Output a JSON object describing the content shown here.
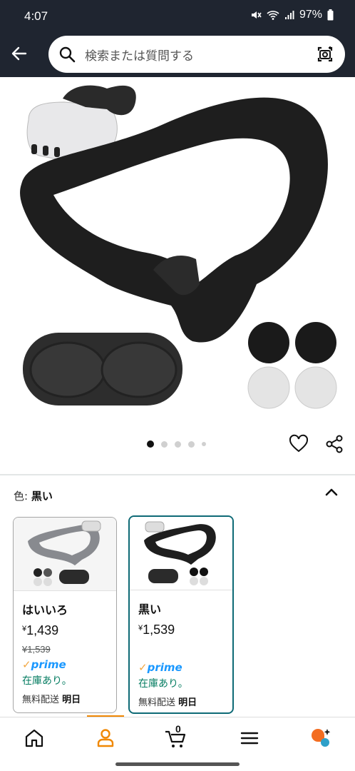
{
  "status_bar": {
    "time": "4:07",
    "battery": "97%"
  },
  "search": {
    "placeholder": "検索または質問する"
  },
  "gallery": {
    "dot_count": 5,
    "active_index": 0
  },
  "color_selector": {
    "label": "色:",
    "selected": "黒い"
  },
  "variants": [
    {
      "name": "はいいろ",
      "currency": "¥",
      "price": "1,439",
      "old_price": "¥1,539",
      "prime": "prime",
      "stock": "在庫あり。",
      "shipping_label": "無料配送",
      "shipping_day": "明日"
    },
    {
      "name": "黒い",
      "currency": "¥",
      "price": "1,539",
      "prime": "prime",
      "stock": "在庫あり。",
      "shipping_label": "無料配送",
      "shipping_day": "明日"
    }
  ],
  "bottom_nav": {
    "cart_count": "0",
    "items": [
      "home-icon",
      "account-icon",
      "cart-icon",
      "menu-icon",
      "rufus-icon"
    ]
  },
  "colors": {
    "header_bg": "#1f2530",
    "accent_orange": "#f08804",
    "selected_border": "#0e6a76",
    "prime_blue": "#1a98ff",
    "stock_green": "#067d62"
  }
}
